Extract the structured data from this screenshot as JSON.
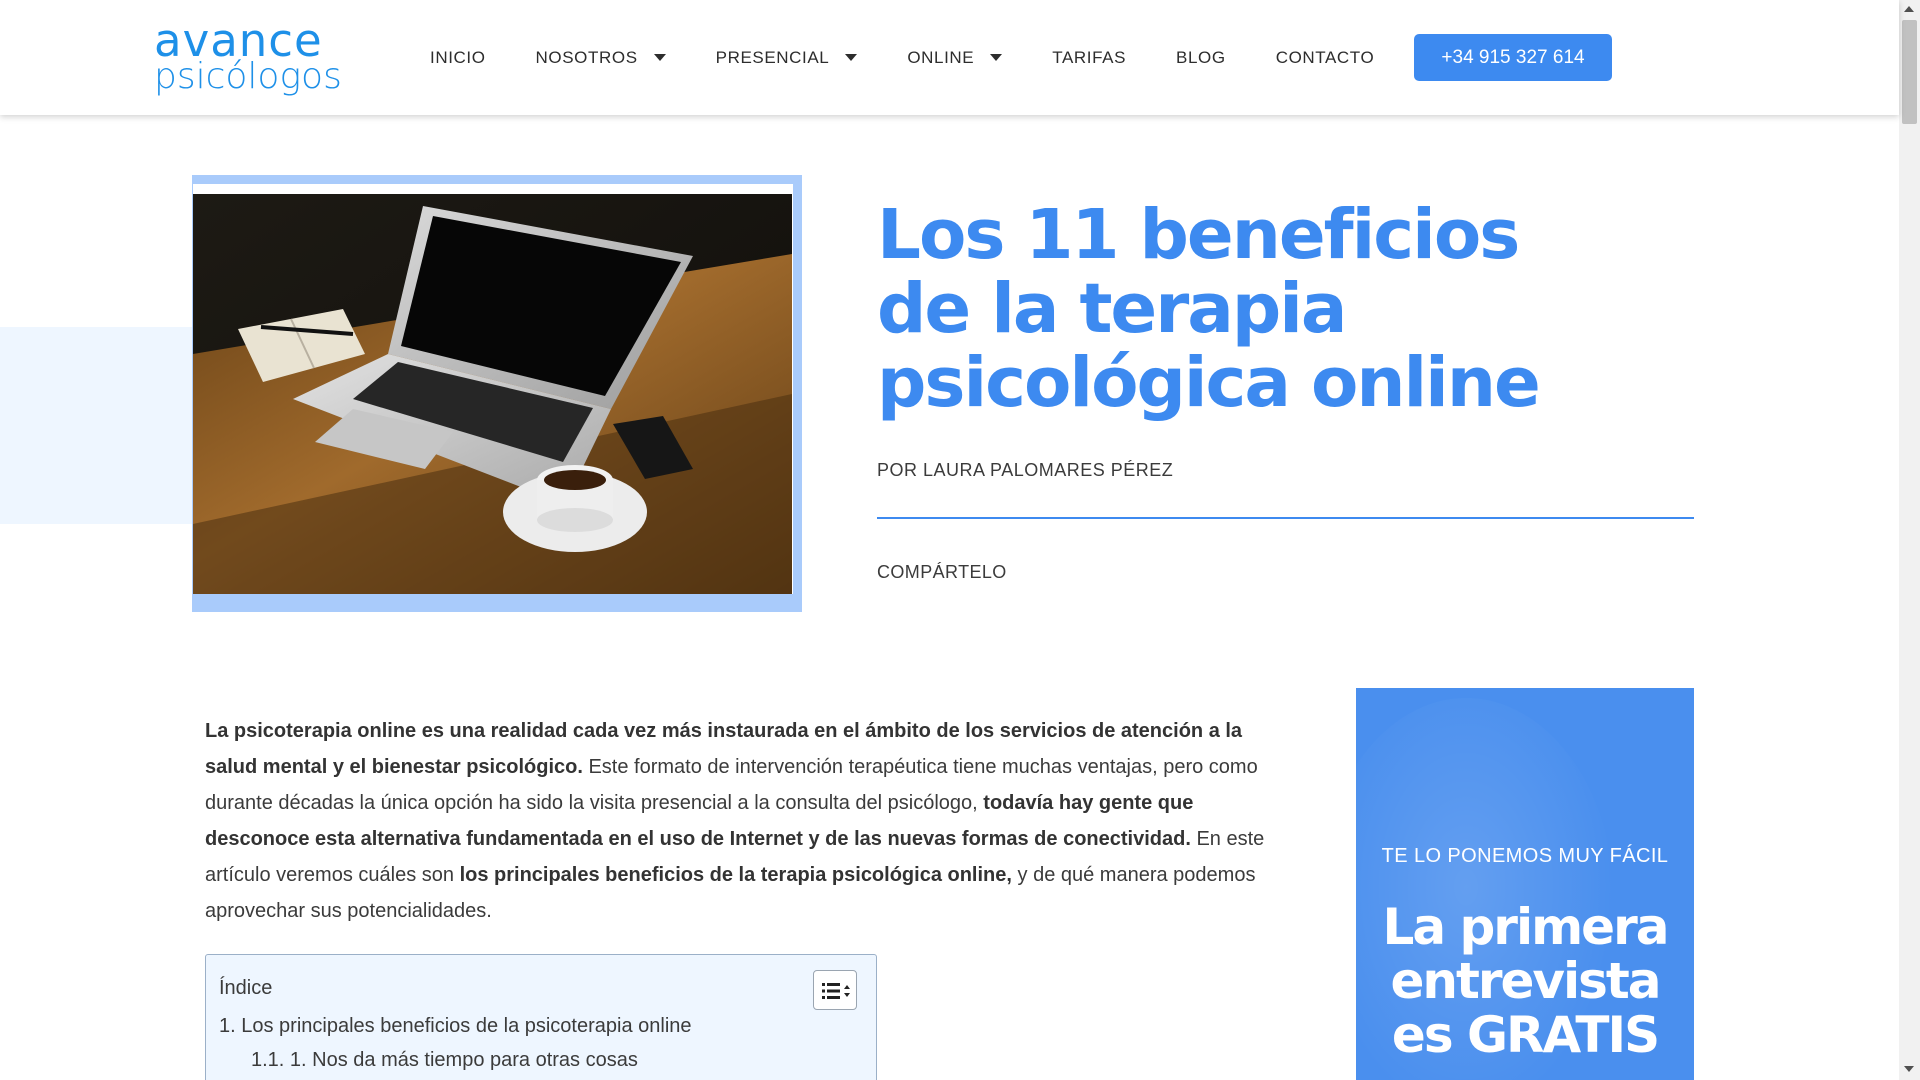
{
  "header": {
    "logo_line1": "avance",
    "logo_line2": "psicólogos",
    "nav": [
      {
        "label": "INICIO",
        "dropdown": false
      },
      {
        "label": "NOSOTROS",
        "dropdown": true
      },
      {
        "label": "PRESENCIAL",
        "dropdown": true
      },
      {
        "label": "ONLINE",
        "dropdown": true
      },
      {
        "label": "TARIFAS",
        "dropdown": false
      },
      {
        "label": "BLOG",
        "dropdown": false
      },
      {
        "label": "CONTACTO",
        "dropdown": false
      }
    ],
    "phone": "+34 915 327 614"
  },
  "hero": {
    "title": "Los 11 beneficios de la terapia psicológica online",
    "byline": "POR LAURA PALOMARES PÉREZ",
    "share": "COMPÁRTELO"
  },
  "article": {
    "intro_parts": [
      {
        "text": "La psicoterapia online es una realidad cada vez más instaurada en el ámbito de los servicios de atención a la salud mental y el bienestar psicológico.",
        "bold": true
      },
      {
        "text": " Este formato de intervención terapéutica tiene muchas ventajas, pero como durante décadas la única opción ha sido la visita presencial a la consulta del psicólogo, ",
        "bold": false
      },
      {
        "text": "todavía hay gente que desconoce esta alternativa fundamentada en el uso de Internet y de las nuevas formas de conectividad.",
        "bold": true
      },
      {
        "text": " En este artículo veremos cuáles son ",
        "bold": false
      },
      {
        "text": "los principales beneficios de la terapia psicológica online,",
        "bold": true
      },
      {
        "text": " y de qué manera podemos aprovechar sus potencialidades.",
        "bold": false
      }
    ]
  },
  "toc": {
    "title": "Índice",
    "items": [
      "1. Los principales beneficios de la psicoterapia online",
      "1.1. 1. Nos da más tiempo para otras cosas"
    ]
  },
  "promo": {
    "kicker": "TE LO PONEMOS MUY FÁCIL",
    "headline": "La primera entrevista es GRATIS"
  },
  "colors": {
    "accent": "#3d8af0",
    "frame": "#a9cbfb",
    "light_bg": "#eef6ff",
    "text": "#3b3b3b"
  }
}
